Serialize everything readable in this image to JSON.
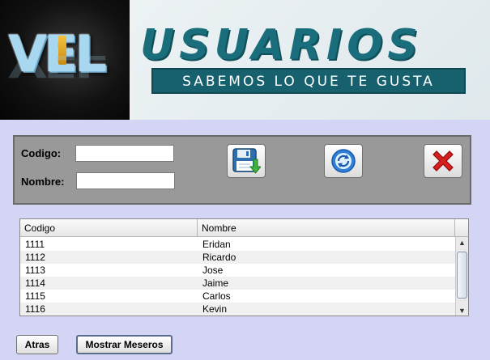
{
  "header": {
    "logo_text": "VEL",
    "banner_title": "USUARIOS",
    "banner_slogan": "SABEMOS LO QUE TE GUSTA"
  },
  "form": {
    "codigo_label": "Codigo:",
    "nombre_label": "Nombre:",
    "codigo_value": "",
    "nombre_value": ""
  },
  "actions": {
    "save_icon": "floppy-disk-save-icon",
    "refresh_icon": "refresh-icon",
    "delete_icon": "delete-x-icon"
  },
  "table": {
    "columns": [
      "Codigo",
      "Nombre"
    ],
    "rows": [
      [
        "1111",
        "Eridan"
      ],
      [
        "1112",
        "Ricardo"
      ],
      [
        "1113",
        "Jose"
      ],
      [
        "1114",
        "Jaime"
      ],
      [
        "1115",
        "Carlos"
      ],
      [
        "1116",
        "Kevin"
      ]
    ]
  },
  "buttons": {
    "atras": "Atras",
    "mostrar_meseros": "Mostrar Meseros"
  },
  "colors": {
    "background": "#d4d4f4",
    "panel": "#999999",
    "banner_accent": "#1a6e7c"
  }
}
